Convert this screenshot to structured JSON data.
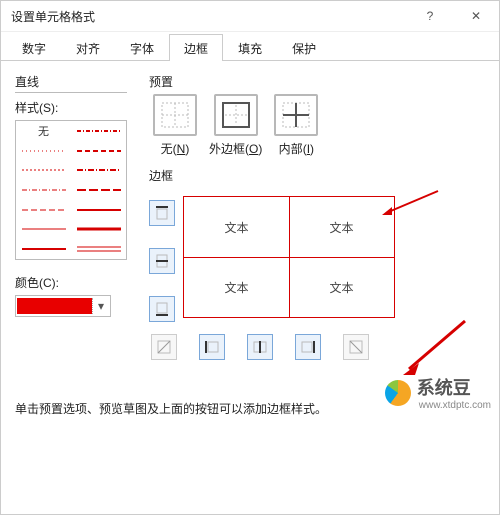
{
  "window": {
    "title": "设置单元格格式",
    "help": "?",
    "close": "✕"
  },
  "tabs": [
    "数字",
    "对齐",
    "字体",
    "边框",
    "填充",
    "保护"
  ],
  "activeTabIndex": 3,
  "line": {
    "section": "直线",
    "style_label": "样式(S):",
    "none": "无"
  },
  "color": {
    "label": "颜色(C):",
    "value": "#e80000"
  },
  "presets": {
    "section": "预置",
    "items": [
      {
        "label": "无",
        "hotkey": "N"
      },
      {
        "label": "外边框",
        "hotkey": "O"
      },
      {
        "label": "内部",
        "hotkey": "I"
      }
    ]
  },
  "border": {
    "section": "边框",
    "sample": "文本"
  },
  "hint": "单击预置选项、预览草图及上面的按钮可以添加边框样式。",
  "watermark": {
    "name": "系统豆",
    "url": "www.xtdptc.com"
  }
}
